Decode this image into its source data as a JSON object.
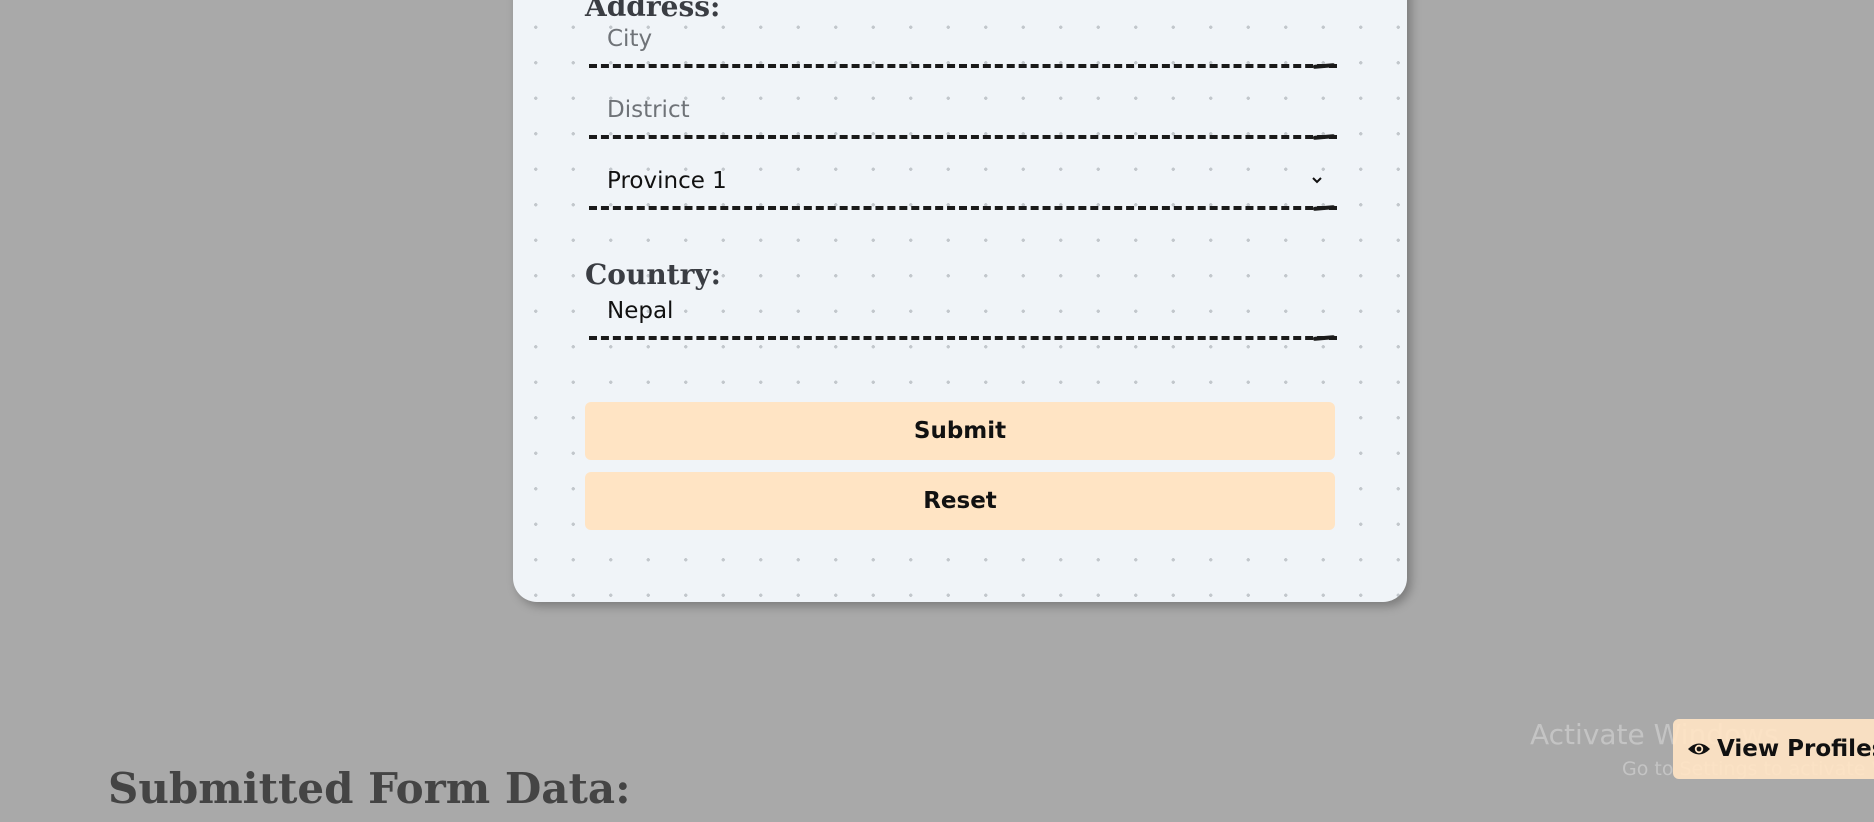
{
  "form": {
    "address_label": "Address:",
    "city_placeholder": "City",
    "district_placeholder": "District",
    "province_selected": "Province 1",
    "country_label": "Country:",
    "country_value": "Nepal",
    "submit_label": "Submit",
    "reset_label": "Reset"
  },
  "submitted": {
    "heading": "Submitted Form Data:"
  },
  "floating": {
    "view_profiles_label": "View Profiles",
    "icon": "eye-icon"
  },
  "watermark": {
    "title": "Activate Windows",
    "subtitle": "Go to Settings to activate Windows."
  },
  "colors": {
    "page_background": "#a9a9a9",
    "card_background": "#f0f4f8",
    "button_background": "#ffe4c4"
  }
}
